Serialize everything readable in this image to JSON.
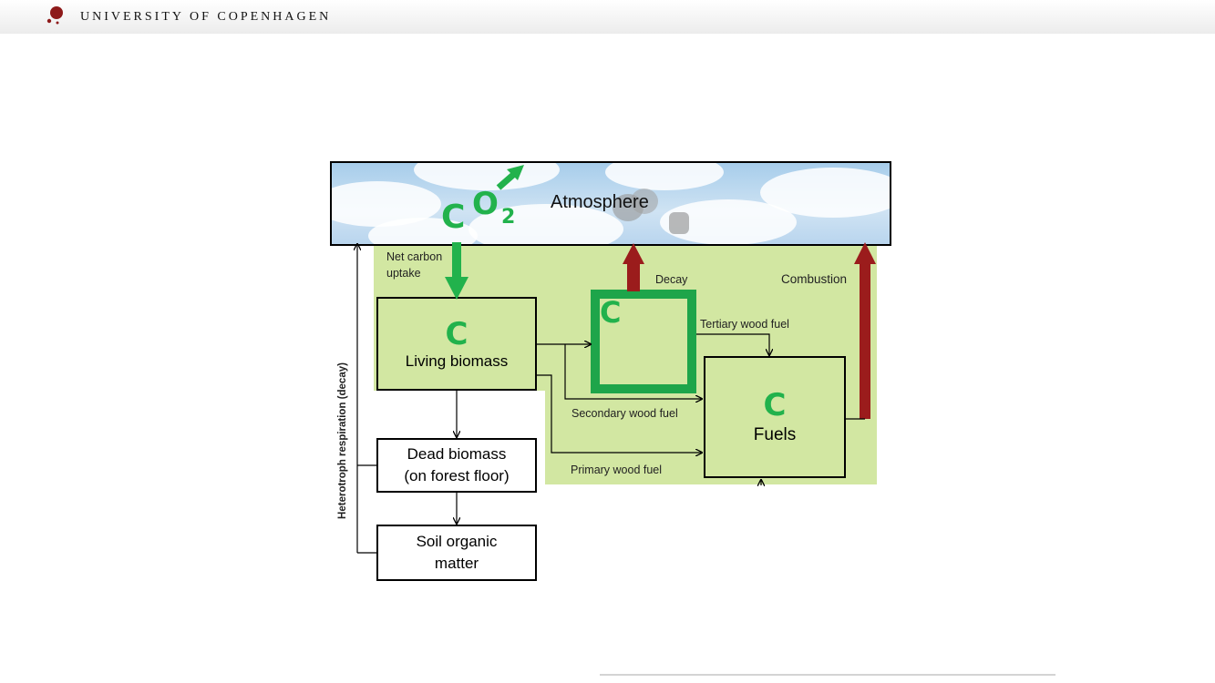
{
  "header": {
    "university": "UNIVERSITY OF COPENHAGEN"
  },
  "diagram": {
    "atmosphere": "Atmosphere",
    "co2": {
      "c": "C",
      "o": "O",
      "sub": "2"
    },
    "carbon_symbol": "C",
    "living_biomass": "Living biomass",
    "fuels": "Fuels",
    "dead_biomass": [
      "Dead biomass",
      "(on forest floor)"
    ],
    "soil_organic_matter": [
      "Soil organic",
      "matter"
    ],
    "labels": {
      "net_carbon_uptake": [
        "Net carbon",
        "uptake"
      ],
      "decay": "Decay",
      "combustion": "Combustion",
      "tertiary_wood_fuel": "Tertiary wood fuel",
      "secondary_wood_fuel": "Secondary wood fuel",
      "primary_wood_fuel": "Primary wood fuel",
      "heterotroph_respiration": "Heterotroph respiration (decay)"
    },
    "colors": {
      "uptake": "#22b24c",
      "emission": "#9b1c1c",
      "panel": "#d2e7a2"
    }
  }
}
